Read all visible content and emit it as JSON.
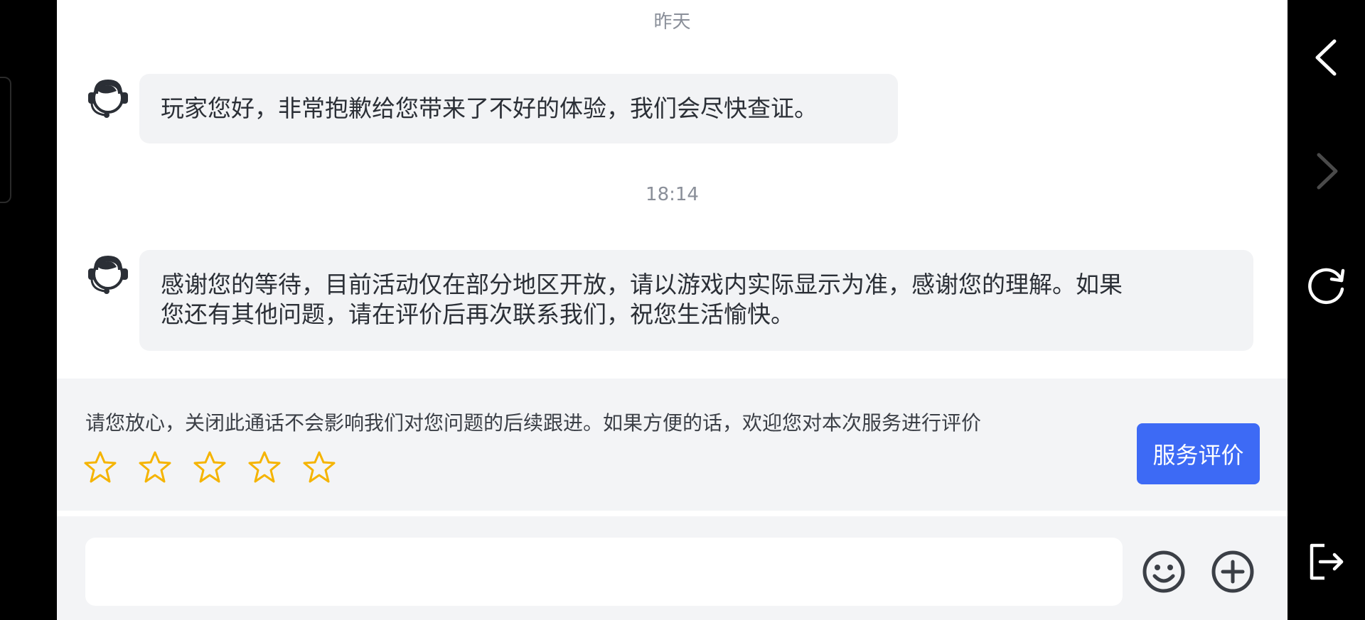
{
  "chat": {
    "sections": [
      {
        "time": "昨天",
        "message": [
          "玩家您好，非常抱歉给您带来了不好的体验，我们会尽快查证。"
        ]
      },
      {
        "time": "18:14",
        "message": [
          "感谢您的等待，目前活动仅在部分地区开放，请以游戏内实际显示为准，感谢您的理解。如果",
          "您还有其他问题，请在评价后再次联系我们，祝您生活愉快。"
        ]
      }
    ],
    "avatar_icon": "customer-service-headset-icon"
  },
  "rating": {
    "prompt": "请您放心，关闭此通话不会影响我们对您问题的后续跟进。如果方便的话，欢迎您对本次服务进行评价",
    "stars": 5,
    "star_color": "#f5b400",
    "button_label": "服务评价",
    "button_color": "#3d6af5"
  },
  "input": {
    "value": "",
    "placeholder": "",
    "emoji_icon": "smiley-icon",
    "add_icon": "plus-circle-icon"
  },
  "nav_rail": {
    "icons": [
      "back-arrow-icon",
      "forward-arrow-icon",
      "refresh-icon",
      "exit-icon"
    ]
  }
}
